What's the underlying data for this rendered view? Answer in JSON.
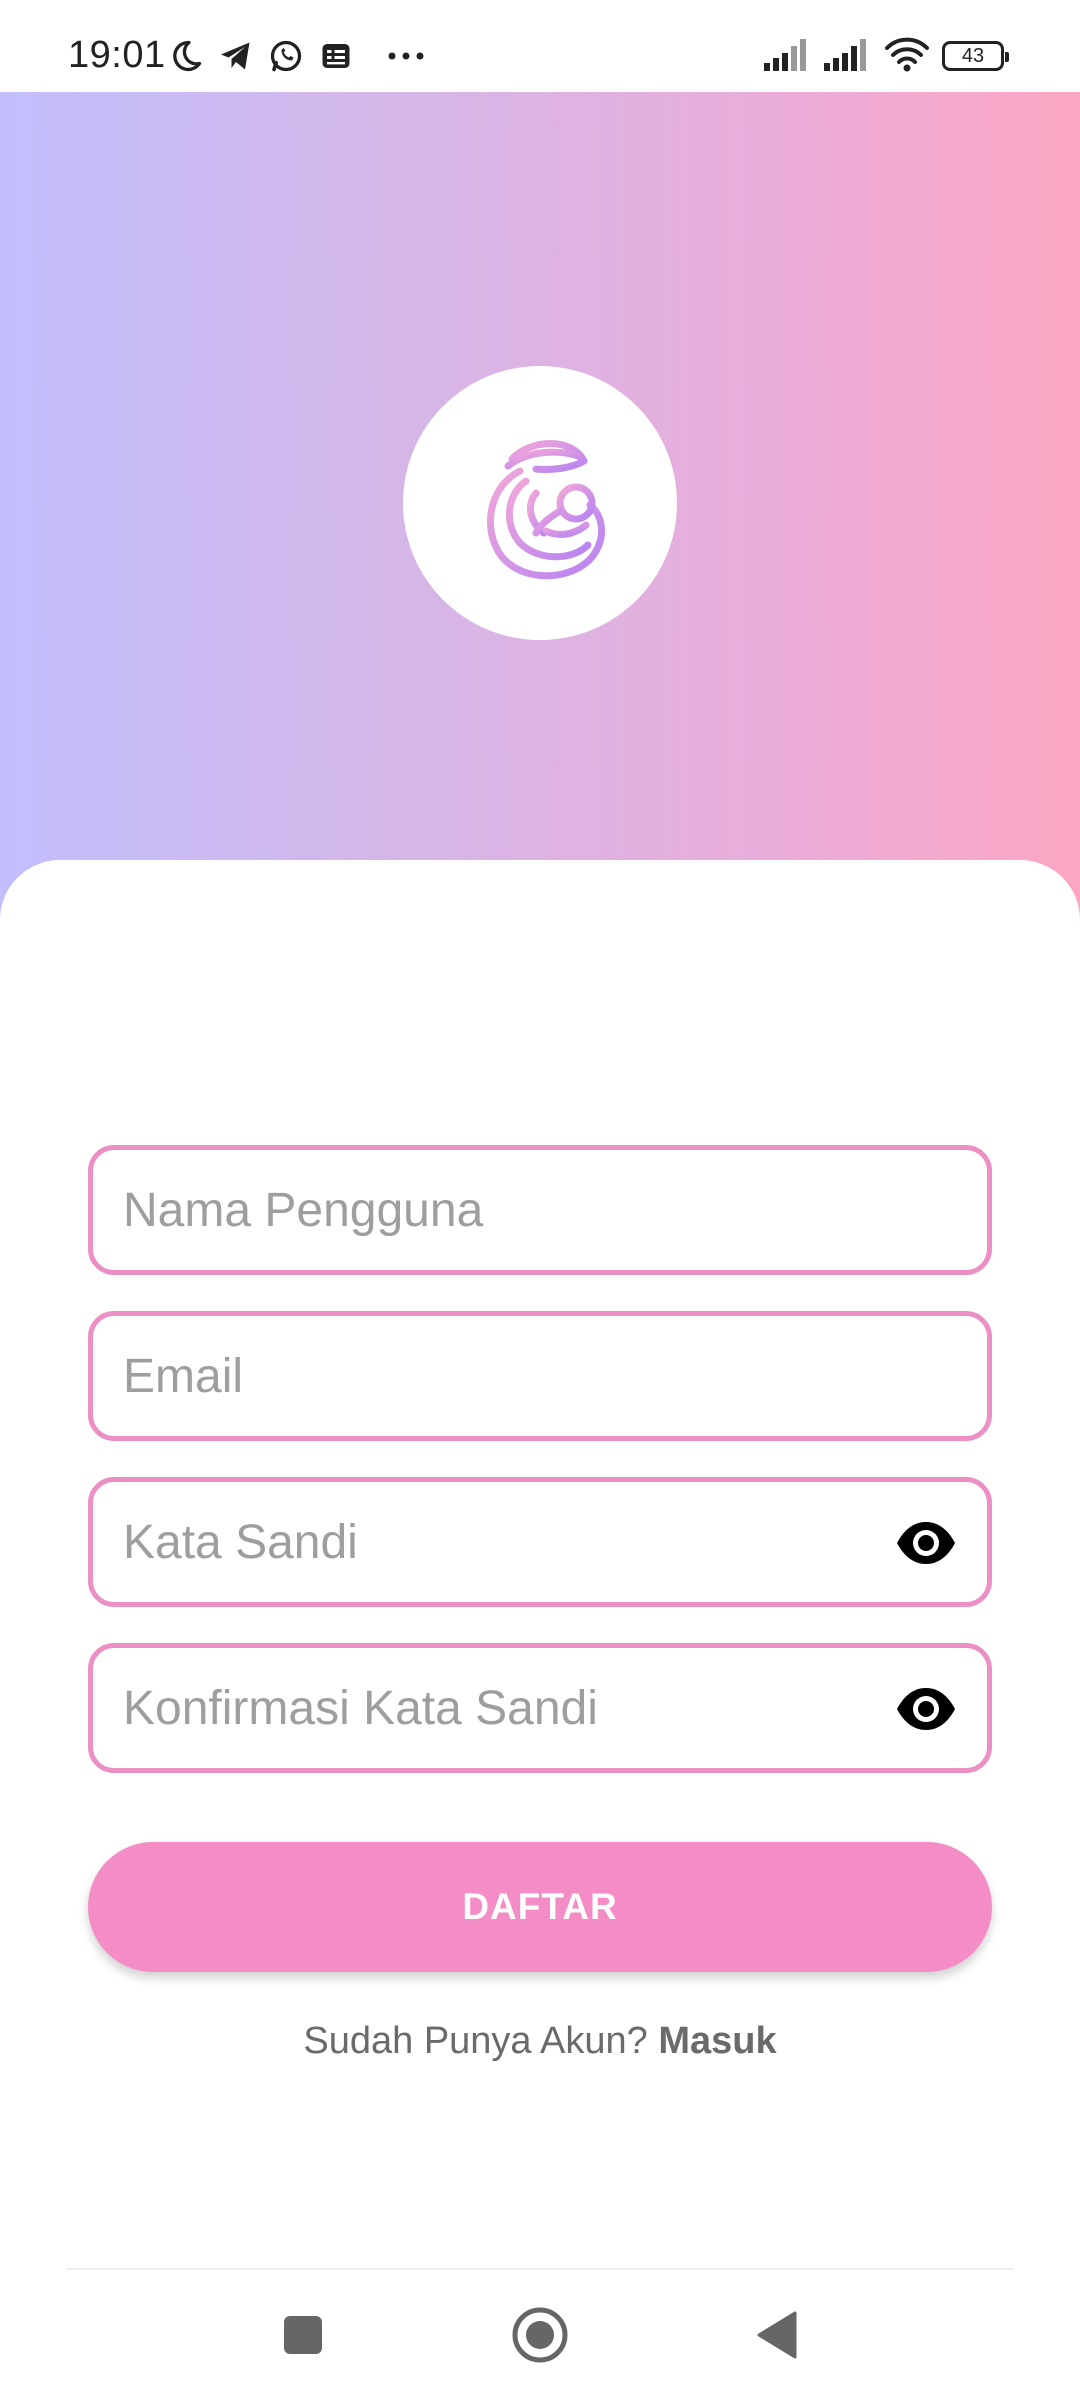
{
  "status_bar": {
    "time": "19:01",
    "battery_level": "43",
    "left_icons": [
      "moon-icon",
      "telegram-icon",
      "whatsapp-icon",
      "notes-icon",
      "more-dots-icon"
    ],
    "right_icons": [
      "signal-icon",
      "signal-icon",
      "wifi-icon",
      "battery-icon"
    ]
  },
  "header": {
    "logo_icon": "mother-baby-logo-icon",
    "gradient_colors": [
      "#c2befd",
      "#fca6c3"
    ]
  },
  "form": {
    "username": {
      "placeholder": "Nama Pengguna",
      "value": ""
    },
    "email": {
      "placeholder": "Email",
      "value": ""
    },
    "password": {
      "placeholder": "Kata Sandi",
      "value": "",
      "toggle_icon": "eye-icon"
    },
    "confirm_password": {
      "placeholder": "Konfirmasi Kata Sandi",
      "value": "",
      "toggle_icon": "eye-icon"
    },
    "border_color": "#ec8fc4"
  },
  "register_button": {
    "label": "DAFTAR",
    "color": "#f48dc6"
  },
  "login_prompt": {
    "text": "Sudah Punya Akun?",
    "link": "Masuk"
  },
  "nav_bar": {
    "items": [
      "recents-square-icon",
      "home-circle-icon",
      "back-triangle-icon"
    ]
  }
}
